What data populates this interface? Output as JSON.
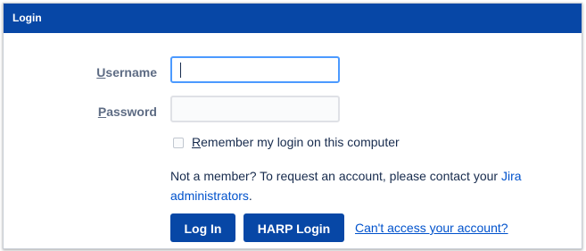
{
  "header": {
    "title": "Login"
  },
  "form": {
    "username_label_key": "U",
    "username_label_rest": "sername",
    "username_value": "",
    "password_label_key": "P",
    "password_label_rest": "assword",
    "password_value": "",
    "remember_checked": false,
    "remember_label_key": "R",
    "remember_label_rest": "emember my login on this computer"
  },
  "info": {
    "text": "Not a member? To request an account, please contact your ",
    "link_text": "Jira administrators",
    "suffix": "."
  },
  "buttons": {
    "login_label": "Log In",
    "harp_label": "HARP Login",
    "cant_access_label": "Can't access your account?"
  },
  "colors": {
    "header_bg": "#0747a6",
    "button_bg": "#0747a6",
    "link": "#0052cc",
    "focus_border": "#4c9aff"
  }
}
